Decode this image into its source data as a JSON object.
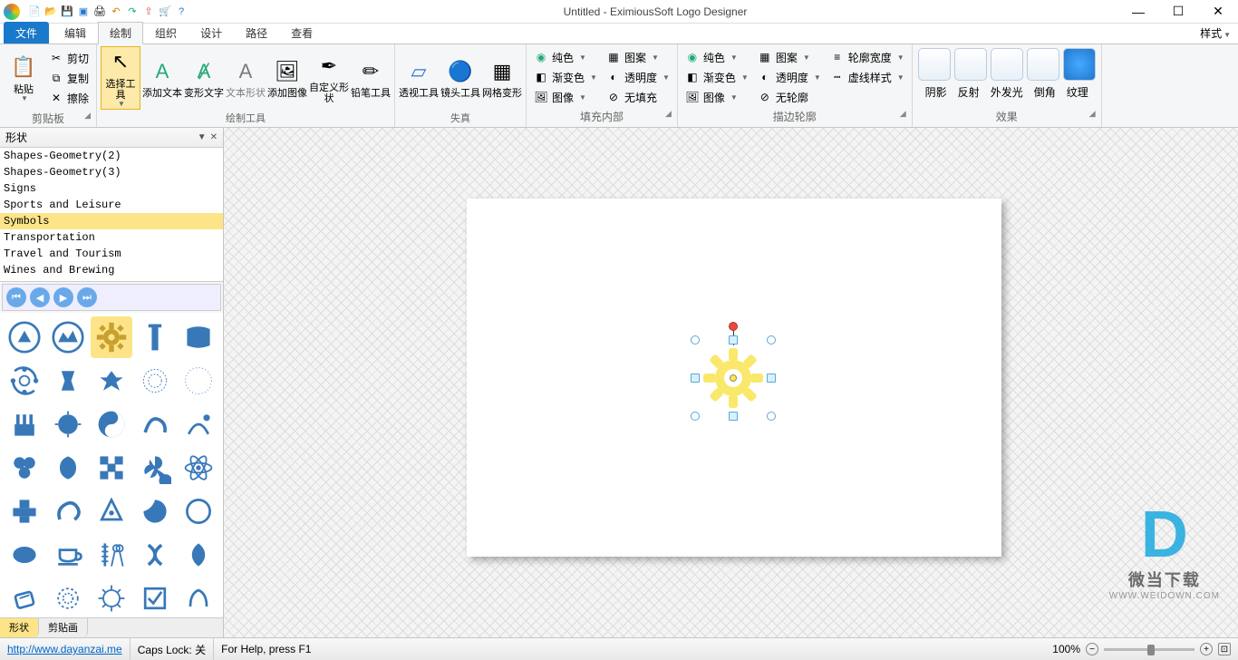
{
  "window": {
    "title": "Untitled - EximiousSoft Logo Designer"
  },
  "tabs": {
    "file": "文件",
    "items": [
      "编辑",
      "绘制",
      "组织",
      "设计",
      "路径",
      "查看"
    ],
    "active": 1,
    "style_btn": "样式"
  },
  "ribbon": {
    "clipboard": {
      "paste": "粘贴",
      "cut": "剪切",
      "copy": "复制",
      "erase": "擦除",
      "label": "剪贴板"
    },
    "tools": {
      "select": "选择工具",
      "addtext": "添加文本",
      "transform": "变形文字",
      "textshape": "文本形状",
      "addimg": "添加图像",
      "custom": "自定义形状",
      "pencil": "铅笔工具",
      "label": "绘制工具"
    },
    "distort": {
      "persp": "透视工具",
      "lens": "镜头工具",
      "mesh": "网格变形",
      "label": "失真"
    },
    "fill": {
      "solid": "纯色",
      "pattern": "图案",
      "gradient": "渐变色",
      "opacity": "透明度",
      "image": "图像",
      "nofill": "无填充",
      "label": "填充内部"
    },
    "stroke": {
      "solid": "纯色",
      "pattern": "图案",
      "width": "轮廓宽度",
      "gradient": "渐变色",
      "opacity": "透明度",
      "dash": "虚线样式",
      "image": "图像",
      "nostroke": "无轮廓",
      "label": "描边轮廓"
    },
    "effects": {
      "shadow": "阴影",
      "reflect": "反射",
      "glow": "外发光",
      "bevel": "倒角",
      "texture": "纹理",
      "label": "效果"
    }
  },
  "sidepanel": {
    "title": "形状",
    "categories": [
      "Shapes-Geometry(2)",
      "Shapes-Geometry(3)",
      "Signs",
      "Sports and Leisure",
      "Symbols",
      "Transportation",
      "Travel and Tourism",
      "Wines and Brewing"
    ],
    "selected_category": 4,
    "bottom_tabs": [
      "形状",
      "剪贴画"
    ],
    "selected_bottom_tab": 0
  },
  "statusbar": {
    "url": "http://www.dayanzai.me",
    "capslock": "Caps Lock: 关",
    "help": "For Help, press F1",
    "zoom": "100%"
  },
  "watermark": {
    "brand": "微当下载",
    "url": "WWW.WEIDOWN.COM"
  }
}
